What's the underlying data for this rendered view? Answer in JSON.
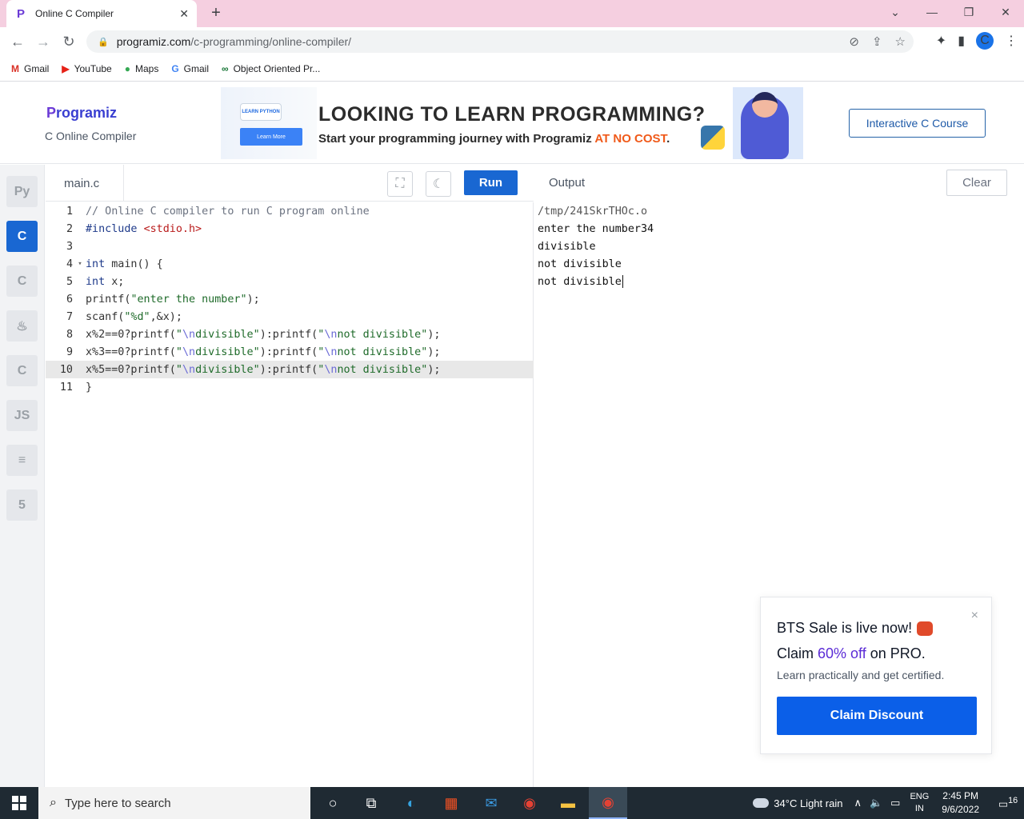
{
  "browser": {
    "tab_title": "Online C Compiler",
    "tab_close": "✕",
    "new_tab": "+",
    "url_host": "programiz.com",
    "url_path": "/c-programming/online-compiler/",
    "profile_initial": "C",
    "bookmarks": [
      {
        "icon": "M",
        "icon_color": "#d93025",
        "label": "Gmail"
      },
      {
        "icon": "▶",
        "icon_color": "#e62117",
        "label": "YouTube"
      },
      {
        "icon": "●",
        "icon_color": "#34a853",
        "label": "Maps"
      },
      {
        "icon": "G",
        "icon_color": "#4285f4",
        "label": "Gmail"
      },
      {
        "icon": "∞",
        "icon_color": "#137333",
        "label": "Object Oriented Pr..."
      }
    ]
  },
  "site": {
    "logo_p": "P",
    "logo_text": "rogramiz",
    "subtitle": "C Online Compiler",
    "banner": {
      "badge": "LEARN PYTHON",
      "learn_more": "Learn More",
      "headline": "LOOKING TO LEARN PROGRAMMING?",
      "tagline_prefix": "Start your programming journey with Programiz ",
      "tagline_accent": "AT NO COST",
      "tagline_suffix": "."
    },
    "course_button": "Interactive C Course"
  },
  "languages": [
    {
      "name": "python",
      "glyph": "Py"
    },
    {
      "name": "c",
      "glyph": "C",
      "active": true
    },
    {
      "name": "cpp",
      "glyph": "C"
    },
    {
      "name": "java",
      "glyph": "♨"
    },
    {
      "name": "csharp",
      "glyph": "C"
    },
    {
      "name": "javascript",
      "glyph": "JS"
    },
    {
      "name": "sql",
      "glyph": "≡"
    },
    {
      "name": "html",
      "glyph": "5"
    }
  ],
  "editor": {
    "filename": "main.c",
    "run_label": "Run",
    "current_line": 10,
    "lines": [
      {
        "n": "1",
        "fold": "",
        "tokens": [
          {
            "t": "// Online C compiler to run C program online",
            "c": "c-comment"
          }
        ]
      },
      {
        "n": "2",
        "fold": "",
        "tokens": [
          {
            "t": "#include ",
            "c": "c-inc"
          },
          {
            "t": "<stdio.h>",
            "c": "c-hdr"
          }
        ]
      },
      {
        "n": "3",
        "fold": "",
        "tokens": []
      },
      {
        "n": "4",
        "fold": "▾",
        "tokens": [
          {
            "t": "int",
            "c": "c-kw"
          },
          {
            "t": " main() {",
            "c": ""
          }
        ]
      },
      {
        "n": "5",
        "fold": "",
        "tokens": [
          {
            "t": "int",
            "c": "c-kw"
          },
          {
            "t": " x;",
            "c": ""
          }
        ]
      },
      {
        "n": "6",
        "fold": "",
        "tokens": [
          {
            "t": "printf(",
            "c": ""
          },
          {
            "t": "\"enter the number\"",
            "c": "c-str"
          },
          {
            "t": ");",
            "c": ""
          }
        ]
      },
      {
        "n": "7",
        "fold": "",
        "tokens": [
          {
            "t": "scanf(",
            "c": ""
          },
          {
            "t": "\"%d\"",
            "c": "c-str"
          },
          {
            "t": ",&x);",
            "c": ""
          }
        ]
      },
      {
        "n": "8",
        "fold": "",
        "tokens": [
          {
            "t": "x%2==0?printf(",
            "c": ""
          },
          {
            "t": "\"",
            "c": "c-str"
          },
          {
            "t": "\\n",
            "c": "c-esc"
          },
          {
            "t": "divisible\"",
            "c": "c-str"
          },
          {
            "t": "):printf(",
            "c": ""
          },
          {
            "t": "\"",
            "c": "c-str"
          },
          {
            "t": "\\n",
            "c": "c-esc"
          },
          {
            "t": "not divisible\"",
            "c": "c-str"
          },
          {
            "t": ");",
            "c": ""
          }
        ]
      },
      {
        "n": "9",
        "fold": "",
        "tokens": [
          {
            "t": "x%3==0?printf(",
            "c": ""
          },
          {
            "t": "\"",
            "c": "c-str"
          },
          {
            "t": "\\n",
            "c": "c-esc"
          },
          {
            "t": "divisible\"",
            "c": "c-str"
          },
          {
            "t": "):printf(",
            "c": ""
          },
          {
            "t": "\"",
            "c": "c-str"
          },
          {
            "t": "\\n",
            "c": "c-esc"
          },
          {
            "t": "not divisible\"",
            "c": "c-str"
          },
          {
            "t": ");",
            "c": ""
          }
        ]
      },
      {
        "n": "10",
        "fold": "",
        "tokens": [
          {
            "t": "x%5==0?printf(",
            "c": ""
          },
          {
            "t": "\"",
            "c": "c-str"
          },
          {
            "t": "\\n",
            "c": "c-esc"
          },
          {
            "t": "divisible\"",
            "c": "c-str"
          },
          {
            "t": "):printf(",
            "c": ""
          },
          {
            "t": "\"",
            "c": "c-str"
          },
          {
            "t": "\\n",
            "c": "c-esc"
          },
          {
            "t": "not divisible\"",
            "c": "c-str"
          },
          {
            "t": ");",
            "c": ""
          }
        ]
      },
      {
        "n": "11",
        "fold": "",
        "tokens": [
          {
            "t": "}",
            "c": ""
          }
        ]
      }
    ]
  },
  "output": {
    "title": "Output",
    "clear_label": "Clear",
    "lines": [
      "/tmp/241SkrTHOc.o",
      "enter the number34",
      "divisible",
      "not divisible",
      "not divisible"
    ]
  },
  "promo": {
    "line1": "BTS Sale is live now!",
    "line2_prefix": "Claim ",
    "line2_highlight": "60% off",
    "line2_suffix": " on PRO.",
    "line3": "Learn practically and get certified.",
    "cta": "Claim Discount",
    "close": "×"
  },
  "taskbar": {
    "search_placeholder": "Type here to search",
    "weather": "34°C  Light rain",
    "lang_top": "ENG",
    "lang_bottom": "IN",
    "time": "2:45 PM",
    "date": "9/6/2022",
    "notifications": "16"
  }
}
